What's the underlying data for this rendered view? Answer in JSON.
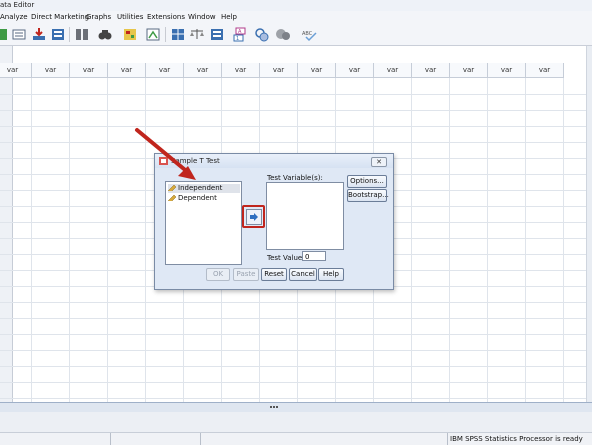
{
  "window": {
    "title": "ata Editor"
  },
  "menu": [
    {
      "label": "Analyze"
    },
    {
      "label": "Direct Marketing"
    },
    {
      "label": "Graphs"
    },
    {
      "label": "Utilities"
    },
    {
      "label": "Extensions"
    },
    {
      "label": "Window"
    },
    {
      "label": "Help"
    }
  ],
  "toolbar_icons": [
    "data-icon",
    "import-icon",
    "recall-dialog-icon",
    "goto-case-icon",
    "goto-variable-icon",
    "variables-icon",
    "find-icon",
    "insert-cases-icon",
    "insert-variable-icon",
    "split-file-icon",
    "weight-cases-icon",
    "select-cases-icon",
    "value-labels-icon",
    "use-sets-icon",
    "show-all-icon",
    "spelling-icon"
  ],
  "grid": {
    "columns": [
      "var",
      "var",
      "var",
      "var",
      "var",
      "var",
      "var",
      "var",
      "var",
      "var",
      "var",
      "var",
      "var",
      "var",
      "var"
    ]
  },
  "status": {
    "processor": "IBM SPSS Statistics Processor is ready"
  },
  "dialog": {
    "title": "Sample T Test",
    "close_label": "✕",
    "variables": [
      {
        "label": "Independent",
        "selected": true
      },
      {
        "label": "Dependent",
        "selected": false
      }
    ],
    "test_variables_label": "Test Variable(s):",
    "test_value_label": "Test Value:",
    "test_value": "0",
    "options_label": "Options...",
    "bootstrap_label": "Bootstrap...",
    "ok_label": "OK",
    "paste_label": "Paste",
    "reset_label": "Reset",
    "cancel_label": "Cancel",
    "help_label": "Help"
  },
  "colors": {
    "highlight_red": "#c0251d",
    "dialog_bg": "#dfe8f5"
  }
}
